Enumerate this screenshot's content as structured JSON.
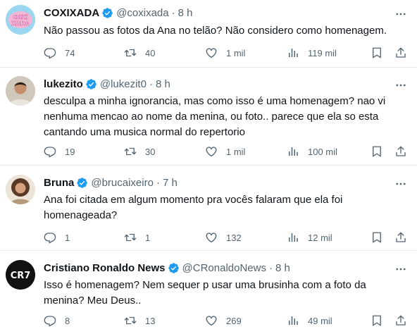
{
  "tweets": [
    {
      "name": "COXIXADA",
      "handle": "@coxixada",
      "time": "8 h",
      "avatar_text": "COXI XADA",
      "text": "Não passou as fotos da Ana no telão? Não considero como homenagem.",
      "replies": "74",
      "retweets": "40",
      "likes": "1 mil",
      "views": "119 mil"
    },
    {
      "name": "lukezito",
      "handle": "@lukezit0",
      "time": "8 h",
      "text": "desculpa a minha ignorancia, mas como isso é uma homenagem? nao vi nenhuma mencao ao nome da menina, ou foto.. parece que ela so esta cantando uma musica normal do repertorio",
      "replies": "19",
      "retweets": "30",
      "likes": "1 mil",
      "views": "100 mil"
    },
    {
      "name": "Bruna",
      "handle": "@brucaixeiro",
      "time": "7 h",
      "text": "Ana foi citada em algum momento pra vocês falaram que ela foi homenageada?",
      "replies": "1",
      "retweets": "1",
      "likes": "132",
      "views": "12 mil"
    },
    {
      "name": "Cristiano Ronaldo News",
      "handle": "@CRonaldoNews",
      "time": "8 h",
      "avatar_text": "CR7",
      "text": "Isso é homenagem? Nem sequer p usar uma brusinha com a foto da menina? Meu Deus..",
      "replies": "8",
      "retweets": "13",
      "likes": "269",
      "views": "49 mil"
    }
  ],
  "dot": "·",
  "colors": {
    "verified": "#1d9bf0",
    "secondary_text": "#536471",
    "divider": "#e6ecf0"
  },
  "icons": [
    "verified-badge-icon",
    "more-options-icon",
    "reply-icon",
    "retweet-icon",
    "like-icon",
    "views-icon",
    "bookmark-icon",
    "share-icon"
  ]
}
